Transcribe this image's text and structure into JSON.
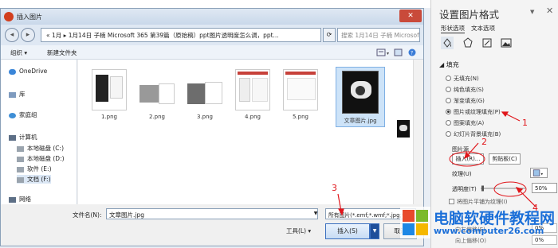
{
  "dialog": {
    "title": "插入图片",
    "close": "✕",
    "path": "« 1月 ▸ 1月14日 子楠 Microsoft 365 第39篇（原始稿）ppt图片透明度怎么调，ppt...",
    "search_placeholder": "搜索 1月14日 子楠 Microsof...",
    "organize": "组织 ▾",
    "new_folder": "新建文件夹",
    "sidebar": [
      {
        "label": "OneDrive",
        "icon": "cloud-icon"
      },
      {
        "label": "库",
        "icon": "library-icon"
      },
      {
        "label": "家庭组",
        "icon": "homegroup-icon"
      },
      {
        "label": "计算机",
        "icon": "computer-icon"
      },
      {
        "label": "本地磁盘 (C:)",
        "icon": "drive-icon"
      },
      {
        "label": "本地磁盘 (D:)",
        "icon": "drive-icon"
      },
      {
        "label": "软件 (E:)",
        "icon": "drive-icon"
      },
      {
        "label": "文档 (F:)",
        "icon": "drive-icon"
      },
      {
        "label": "网络",
        "icon": "network-icon"
      }
    ],
    "files": [
      {
        "name": "1.png"
      },
      {
        "name": "2.png"
      },
      {
        "name": "3.png"
      },
      {
        "name": "4.png"
      },
      {
        "name": "5.png"
      },
      {
        "name": "文章图片.jpg",
        "selected": true
      }
    ],
    "filename_label": "文件名(N):",
    "filename_value": "文章图片.jpg",
    "file_type": "所有图片(*.emf;*.wmf;*.jpg;*.jp",
    "tools": "工具(L)",
    "insert": "插入(S)",
    "cancel": "取消"
  },
  "annotations": [
    "1",
    "2",
    "3",
    "4"
  ],
  "format_pane": {
    "title": "设置图片格式",
    "close": "✕",
    "tabs": [
      "形状选项",
      "文本选项"
    ],
    "fill_header": "◢ 填充",
    "fill_options": [
      {
        "label": "无填充(N)",
        "selected": false
      },
      {
        "label": "纯色填充(S)",
        "selected": false
      },
      {
        "label": "渐变填充(G)",
        "selected": false
      },
      {
        "label": "图片或纹理填充(P)",
        "selected": true
      },
      {
        "label": "图案填充(A)",
        "selected": false
      },
      {
        "label": "幻灯片背景填充(B)",
        "selected": false
      }
    ],
    "source_label": "图片源",
    "insert_btn": "插入(R)...",
    "clipboard_btn": "剪贴板(C)",
    "texture_label": "纹理(U)",
    "transparency_label": "透明度(T)",
    "transparency_value": "50%",
    "transparency_fraction": 0.5,
    "tile_label": "将图片平铺为纹理(I)",
    "offset_x_label": "向左偏移(E)",
    "offset_x_value": "0%",
    "offset_y_label": "向上偏移(O)",
    "offset_y_value": "0%"
  },
  "watermark": {
    "name": "电脑软硬件教程网",
    "url": "www.computer26.com"
  },
  "colors": {
    "annotation": "#e0161b",
    "accent": "#1b6fd8"
  }
}
